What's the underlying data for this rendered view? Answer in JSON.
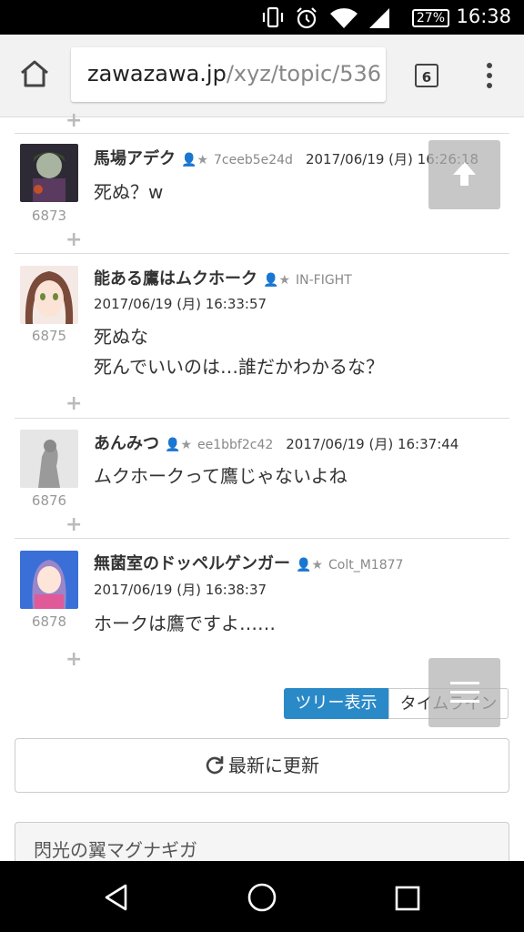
{
  "status_bar": {
    "battery": "27%",
    "time": "16:38"
  },
  "browser": {
    "url_host": "zawazawa.jp",
    "url_path": "/xyz/topic/536",
    "tab_count": "6"
  },
  "posts": [
    {
      "name": "馬場アデク",
      "uid": "7ceeb5e24d",
      "date": "2017/06/19 (月) 16:26:18",
      "num": "6873",
      "lines": [
        "死ぬ？w"
      ]
    },
    {
      "name": "能ある鷹はムクホーク",
      "uid": "IN-FIGHT",
      "date": "2017/06/19 (月) 16:33:57",
      "num": "6875",
      "lines": [
        "死ぬな",
        "死んでいいのは…誰だかわかるな？"
      ]
    },
    {
      "name": "あんみつ",
      "uid": "ee1bbf2c42",
      "date": "2017/06/19 (月) 16:37:44",
      "num": "6876",
      "lines": [
        "ムクホークって鷹じゃないよね"
      ]
    },
    {
      "name": "無菌室のドッペルゲンガー",
      "uid": "Colt_M1877",
      "date": "2017/06/19 (月) 16:38:37",
      "num": "6878",
      "lines": [
        "ホークは鷹ですよ……"
      ]
    }
  ],
  "plus": "+",
  "user_badge": "★",
  "view_toggle": {
    "tree": "ツリー表示",
    "timeline": "タイムライン"
  },
  "refresh_label": "最新に更新",
  "panel_title": "閃光の翼マグナギガ",
  "colors": {
    "accent": "#2a8ac8"
  }
}
